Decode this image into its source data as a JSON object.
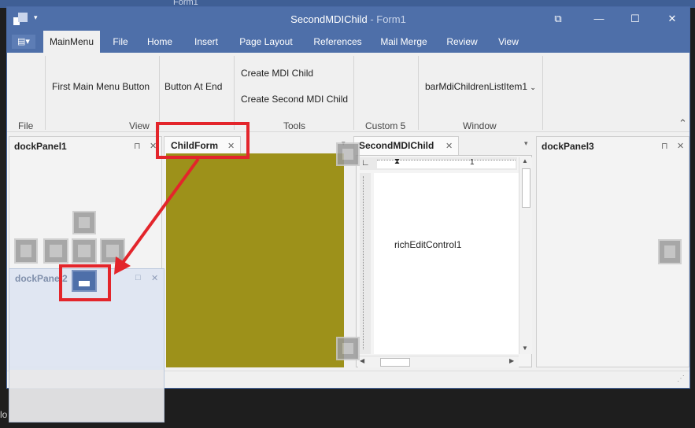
{
  "background_window": {
    "title": "Form1"
  },
  "window": {
    "title": "SecondMDIChild",
    "title_suffix": " - Form1",
    "controls": {
      "restore": "⧉",
      "minimize": "—",
      "maximize": "☐",
      "close": "✕"
    },
    "qat_dropdown": "▾"
  },
  "ribbon": {
    "app_menu_icon": "▤▾",
    "tabs": [
      "MainMenu",
      "File",
      "Home",
      "Insert",
      "Page Layout",
      "References",
      "Mail Merge",
      "Review",
      "View"
    ],
    "groups": {
      "file": {
        "label": "File"
      },
      "view": {
        "label": "View",
        "buttons": [
          "First Main Menu Button",
          "Button At End"
        ]
      },
      "tools": {
        "label": "Tools",
        "buttons": [
          "Create MDI Child",
          "Create Second MDI Child"
        ]
      },
      "custom5": {
        "label": "Custom 5"
      },
      "window": {
        "label": "Window",
        "dropdown": "barMdiChildrenListItem1"
      }
    },
    "collapse_icon": "⌃"
  },
  "dock": {
    "panel1": {
      "caption": "dockPanel1"
    },
    "panel2": {
      "caption": "dockPanel2"
    },
    "panel3": {
      "caption": "dockPanel3"
    },
    "childform_tab": {
      "caption": "ChildForm"
    },
    "second_tab": {
      "caption": "SecondMDIChild"
    },
    "rich_edit": {
      "text": "richEditControl1",
      "ruler_number": "1"
    },
    "pin_icon": "⊓",
    "close_icon": "✕",
    "maximize_icon": "□",
    "dropdown_icon": "▾"
  },
  "colors": {
    "title_bar": "#4e6fa9",
    "child_form_body": "#9d911a",
    "annotation_red": "#e3252b",
    "dock_guide_active": "#4e6fa9"
  },
  "annotation": {
    "arrow_color": "#e3252b"
  }
}
